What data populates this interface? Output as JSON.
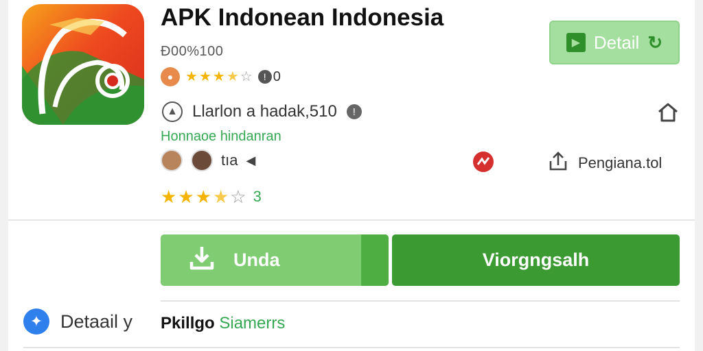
{
  "app": {
    "title": "APK Indonean Indonesia",
    "version": "Ð00%100",
    "small_rating_count": "0",
    "developer_line": "Llarlon a hadak,510",
    "category_link": "Honnaoe hindanran",
    "reviewer_label": "tıa",
    "rating_count": "3",
    "rating_top": 3.5,
    "rating_bottom": 3.5,
    "rating_max": 5
  },
  "header": {
    "detail_button_label": "Detail"
  },
  "share": {
    "label": "Pengiana.tol"
  },
  "actions": {
    "install_label": "Unda",
    "open_label": "Viorgngsalh"
  },
  "details": {
    "label": "Detaail y",
    "link_prefix": "Pkillgo",
    "link_text": "Siamerrs"
  },
  "colors": {
    "accent_green": "#3c9a33",
    "light_green": "#7fcc72",
    "star": "#f4b400",
    "link_green": "#34a853",
    "detail_blue": "#2f80ed",
    "red_badge": "#d62f2f"
  },
  "icons": [
    "app-logo",
    "play-icon",
    "refresh-icon",
    "info-icon",
    "home-icon",
    "share-icon",
    "download-icon",
    "sparkle-icon",
    "flag-icon"
  ]
}
